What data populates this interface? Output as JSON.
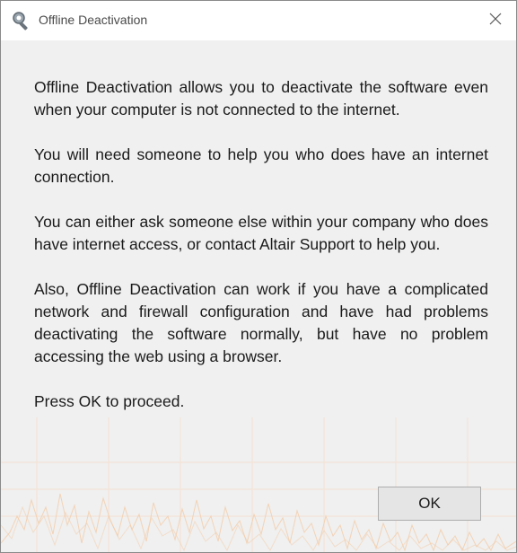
{
  "window": {
    "title": "Offline Deactivation",
    "title_icon": "key-search-icon",
    "close_icon": "close-icon"
  },
  "message": {
    "paragraphs": [
      "Offline Deactivation allows you to deactivate the software even when your computer is not connected to the internet.",
      "You will need someone to help you who does have an internet connection.",
      "You can either ask someone else within your company who does have internet access, or contact Altair Support to help you.",
      "Also, Offline Deactivation can work if you have a complicated network and firewall configuration and have had problems deactivating the software normally, but have no problem accessing the web using a browser.",
      "Press OK to proceed."
    ]
  },
  "buttons": {
    "ok_label": "OK"
  },
  "colors": {
    "dialog_background": "#f0f0f0",
    "titlebar_background": "#ffffff",
    "background_graph": "#f3c9a3"
  }
}
